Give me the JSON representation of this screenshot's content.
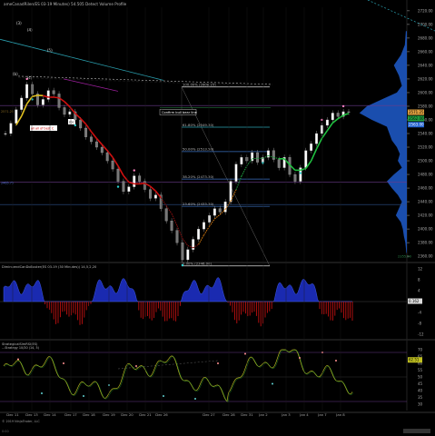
{
  "window": {
    "title": "ameCanadRilen/ES 03-19 Minutes) 54.505 Detect Volume Profile",
    "copyright": "© 2019 NinjaTrader, LLC",
    "footer_left": "0:00"
  },
  "price_panel": {
    "y_ticks": [
      "2720.00",
      "2700.00",
      "2680.00",
      "2660.00",
      "2640.00",
      "2620.00",
      "2600.00",
      "2580.00",
      "2560.00",
      "2540.00",
      "2520.00",
      "2500.00",
      "2480.00",
      "2460.00",
      "2440.00",
      "2420.00",
      "2400.00",
      "2380.00",
      "2360.00"
    ],
    "y_range": [
      2355,
      2725
    ],
    "last_price": "2571.25",
    "price_box_green": "2562.00",
    "price_box_blue": "2563.00",
    "bottom_right_label": "2355.50",
    "fib_levels": [
      {
        "label": "100.00% (2608.25)",
        "price": 2608.25
      },
      {
        "label": "61.80% (2549.30)",
        "price": 2549.3
      },
      {
        "label": "50.00% (2513.50)",
        "price": 2513.5
      },
      {
        "label": "38.20% (2473.30)",
        "price": 2473.3
      },
      {
        "label": "23.60% (2433.30)",
        "price": 2433.3
      },
      {
        "label": "0.00% (2346.00)",
        "price": 2346.0
      }
    ],
    "callout": "Confirm bull bear line",
    "annotation_red": "all all of best C",
    "wave_labels": [
      "(3)",
      "(4)",
      "(5)",
      "(b)",
      "(c)"
    ]
  },
  "osc_panel": {
    "title": "DiminuendCanDoBuster(ES 03-19 (30 Minutes)) 14,5,2,20",
    "y_ticks": [
      "12",
      "8",
      "4",
      "0",
      "-4",
      "-8",
      "-12"
    ],
    "value": "0.162",
    "value_box_color": "#dddddd"
  },
  "rsi_panel": {
    "title_line1": "StrategicalSlmRSI(ES)",
    "title_line2": "...Strategy 10/30 (14, 5)",
    "y_ticks": [
      "70",
      "65",
      "60",
      "55",
      "50",
      "45",
      "40",
      "35",
      "30"
    ],
    "value_box": "62.51"
  },
  "x_axis": {
    "labels": [
      "Dec 11",
      "Dec 13",
      "Dec 14",
      "Dec 17",
      "Dec 18",
      "Dec 19",
      "Dec 20",
      "Dec 21",
      "Dec 26",
      "Dec 27",
      "Dec 28",
      "Dec 31",
      "Jan 2",
      "Jan 3",
      "Jan 4",
      "Jan 7",
      "Jan 8"
    ]
  },
  "chart_data": {
    "type": "line",
    "xlabel": "",
    "ylabel": "",
    "ylim": [
      2355,
      2725
    ],
    "series": [
      {
        "values": [
          2540,
          2555,
          2575,
          2592,
          2612,
          2598,
          2582,
          2590,
          2603,
          2598,
          2578,
          2568,
          2572,
          2560,
          2548,
          2535,
          2528,
          2520,
          2512,
          2500,
          2488,
          2470,
          2455,
          2462,
          2478,
          2470,
          2458,
          2445,
          2450,
          2430,
          2412,
          2398,
          2380,
          2355,
          2370,
          2385,
          2400,
          2410,
          2420,
          2430,
          2425,
          2440,
          2470,
          2495,
          2505,
          2500,
          2512,
          2498,
          2505,
          2515,
          2502,
          2490,
          2505,
          2480,
          2470,
          2490,
          2515,
          2525,
          2540,
          2552,
          2560,
          2570,
          2565,
          2572,
          2571
        ]
      }
    ]
  }
}
